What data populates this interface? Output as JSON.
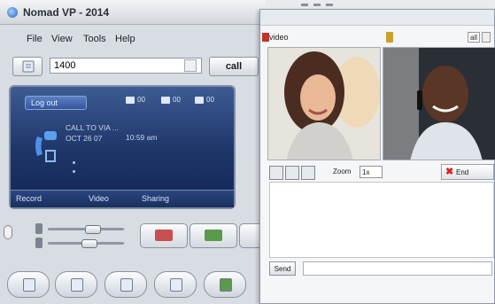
{
  "app": {
    "title": "Nomad VP - 2014"
  },
  "menu": [
    "File",
    "View",
    "Tools",
    "Help"
  ],
  "dial": {
    "value": "1400",
    "call_label": "call"
  },
  "panel": {
    "logout_label": "Log out",
    "stats": [
      "00",
      "00",
      "00"
    ],
    "call_info": [
      "CALL TO VIA ...",
      "OCT 26 07"
    ],
    "call_time": "10:59 am",
    "tabs": [
      "Record",
      "Video",
      "Sharing"
    ]
  },
  "video": {
    "header": "video",
    "select_value": "all",
    "zoom_label": "Zoom",
    "zoom_value": "1x",
    "end_label": "End",
    "send_label": "Send"
  },
  "colors": {
    "panel_bg": "#1d3568",
    "accent": "#3556a0",
    "end_icon": "#dd2222"
  }
}
